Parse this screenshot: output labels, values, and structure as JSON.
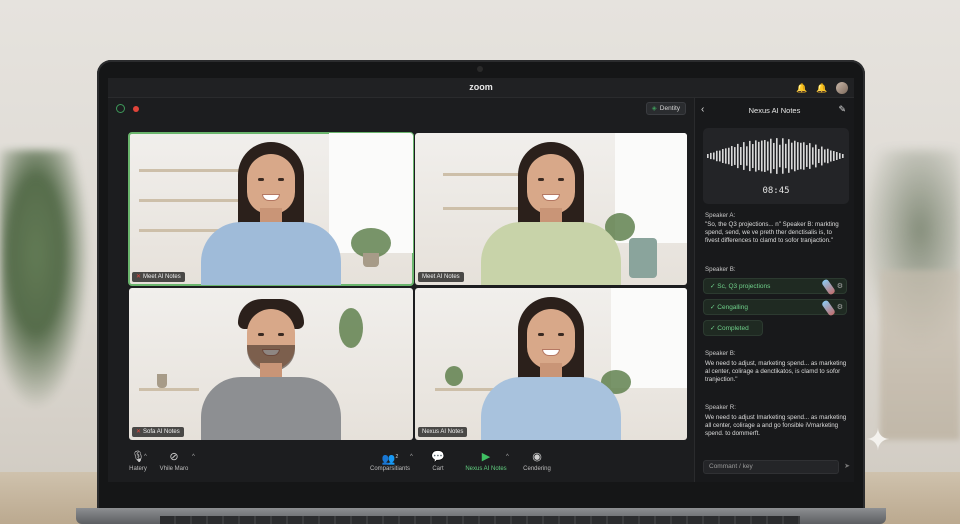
{
  "app": {
    "title": "zoom"
  },
  "topbar": {
    "icons": [
      "bell-icon",
      "notification-bell-icon",
      "avatar"
    ]
  },
  "meeting": {
    "identity_label": "Dentity",
    "tiles": [
      {
        "name": "Meet AI Notes",
        "muted": true,
        "active": true
      },
      {
        "name": "Meet AI Notes",
        "muted": false,
        "active": false
      },
      {
        "name": "Sofa AI Notes",
        "muted": true,
        "active": false
      },
      {
        "name": "Nexus AI Notes",
        "muted": false,
        "active": false
      }
    ]
  },
  "toolbar": {
    "items": [
      {
        "label": "Hatery",
        "icon": "microphone-icon",
        "glyph": "🎙"
      },
      {
        "label": "Vhile Maro",
        "icon": "video-off-icon",
        "glyph": "⊘"
      },
      {
        "label": "Comparsitiants",
        "icon": "participants-icon",
        "glyph": "👥"
      },
      {
        "label": "Cart",
        "icon": "chat-icon",
        "glyph": "💬"
      },
      {
        "label": "Nexus AI Notes",
        "icon": "ai-notes-icon",
        "glyph": "▶"
      },
      {
        "label": "Cendering",
        "icon": "recording-icon",
        "glyph": "◉"
      }
    ],
    "participant_count": "2"
  },
  "panel": {
    "title": "Nexus AI Notes",
    "timer": "08:45",
    "transcript_1_speaker": "Speaker A:",
    "transcript_1_text": "\"So, the Q3 projections... n\" Speaker B: markting spend, send, we ve preth ther denctisalis is, to fivest differences to clamd to sofor tranjaction.\"",
    "transcript_2_speaker": "Speaker B:",
    "chips": [
      "Sc, Q3 projections",
      "Cengalling",
      "Completed"
    ],
    "transcript_3_speaker": "Speaker B:",
    "transcript_3_text": "We need to adjust, marketing spend... as marketing al center, colirage a denctikatos, is clamd to sofor tranjection.\"",
    "transcript_4_speaker": "Speaker R:",
    "transcript_4_text": "We need to adjust Imarketing spend... as marketing all center, colirage a and go fonsible iVmarketing spend. to dommerft.",
    "input_placeholder": "Commant / key"
  }
}
